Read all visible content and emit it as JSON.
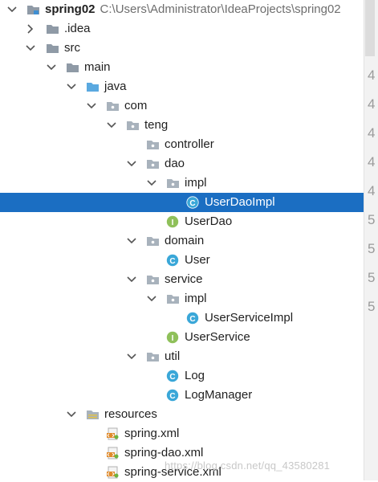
{
  "tree": {
    "project": {
      "name": "spring02",
      "path": "C:\\Users\\Administrator\\IdeaProjects\\spring02"
    },
    "idea": ".idea",
    "src": "src",
    "main": "main",
    "java": "java",
    "com": "com",
    "teng": "teng",
    "controller": "controller",
    "dao": "dao",
    "dao_impl": "impl",
    "userdaoimpl": "UserDaoImpl",
    "userdao": "UserDao",
    "domain": "domain",
    "user": "User",
    "service": "service",
    "service_impl": "impl",
    "userserviceimpl": "UserServiceImpl",
    "userservice": "UserService",
    "util": "util",
    "log": "Log",
    "logmanager": "LogManager",
    "resources": "resources",
    "spring_xml": "spring.xml",
    "spring_dao_xml": "spring-dao.xml",
    "spring_service_xml": "spring-service.xml"
  },
  "gutter": {
    "numbers": [
      "4",
      "4",
      "4",
      "4",
      "4",
      "4",
      "5",
      "5",
      "5",
      "5"
    ]
  },
  "watermark": "https://blog.csdn.net/qq_43580281",
  "colors": {
    "selection": "#1b6ec2",
    "class_icon": "#3aa7d8",
    "interface_icon": "#8fc05a"
  }
}
